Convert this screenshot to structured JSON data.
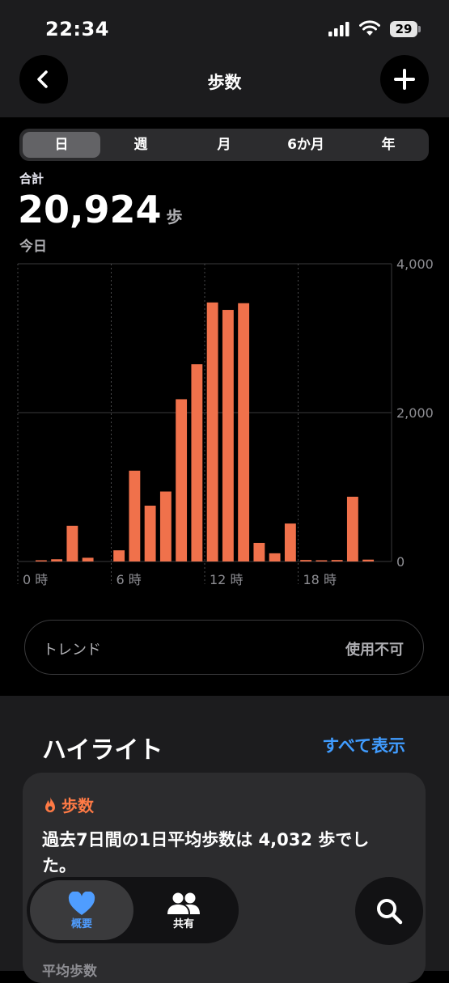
{
  "status": {
    "time": "22:34",
    "battery": "29"
  },
  "header": {
    "title": "歩数"
  },
  "segments": [
    "日",
    "週",
    "月",
    "6か月",
    "年"
  ],
  "summary": {
    "label": "合計",
    "value": "20,924",
    "unit": "歩",
    "date": "今日"
  },
  "chart_data": {
    "type": "bar",
    "x": [
      0,
      1,
      2,
      3,
      4,
      5,
      6,
      7,
      8,
      9,
      10,
      11,
      12,
      13,
      14,
      15,
      16,
      17,
      18,
      19,
      20,
      21,
      22,
      23
    ],
    "values": [
      0,
      10,
      30,
      480,
      50,
      0,
      150,
      1220,
      750,
      940,
      2180,
      2650,
      3480,
      3380,
      3470,
      250,
      110,
      510,
      20,
      10,
      20,
      870,
      25,
      0
    ],
    "x_tick_labels": [
      "0 時",
      "6 時",
      "12 時",
      "18 時"
    ],
    "y_tick_labels": [
      "4,000",
      "2,000",
      "0"
    ],
    "ylim": [
      0,
      4000
    ],
    "bar_color": "#f0714b",
    "grid": true
  },
  "trend": {
    "label": "トレンド",
    "value": "使用不可"
  },
  "highlights": {
    "title": "ハイライト",
    "show_all": "すべて表示",
    "card": {
      "category": "歩数",
      "text": "過去7日間の1日平均歩数は 4,032 歩でした。",
      "sub": "平均歩数"
    }
  },
  "tabs": [
    {
      "label": "概要",
      "icon": "heart-icon",
      "color": "#4f9dff"
    },
    {
      "label": "共有",
      "icon": "people-icon",
      "color": "#ffffff"
    }
  ],
  "colors": {
    "accent": "#f0714b",
    "link": "#409cff"
  }
}
